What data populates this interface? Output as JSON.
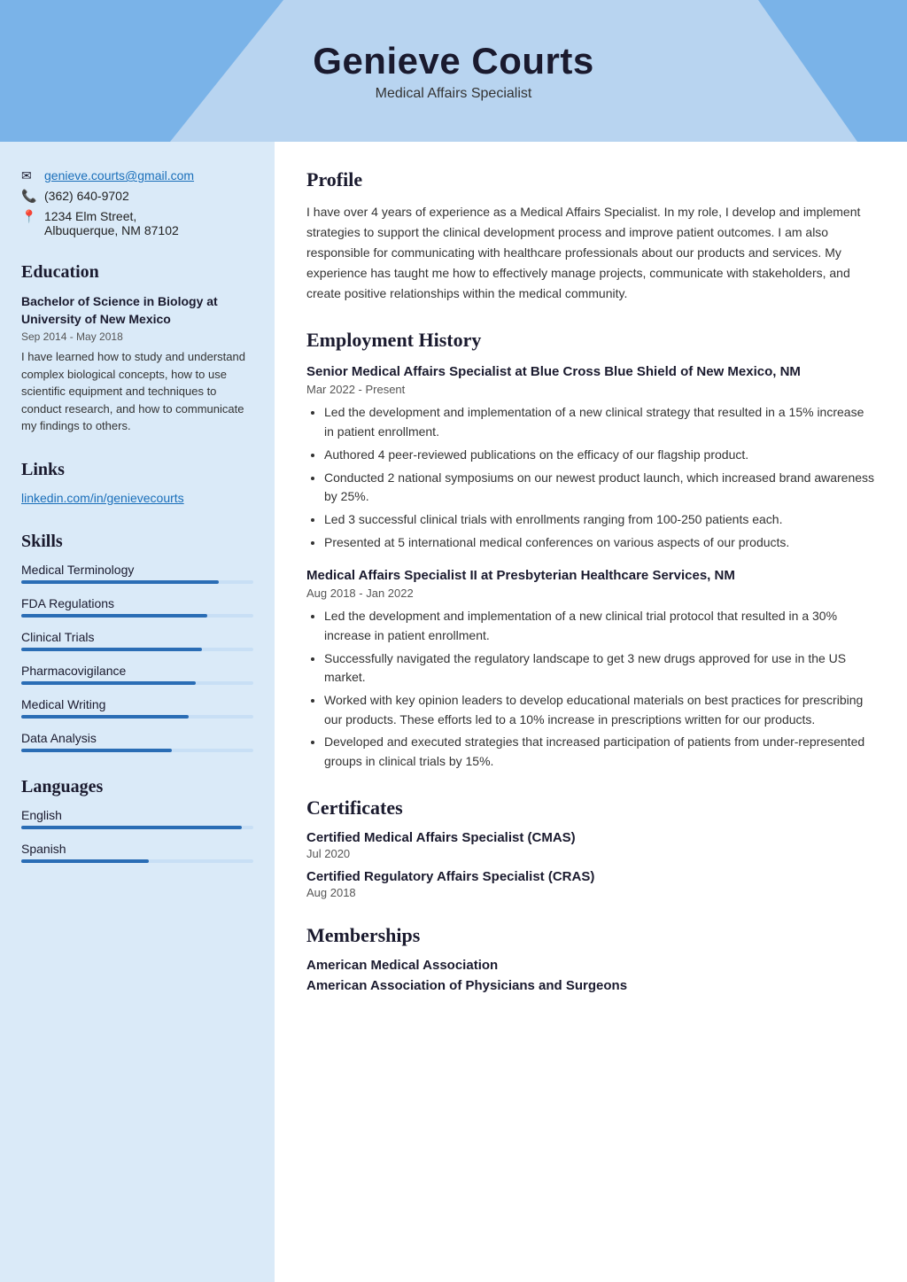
{
  "header": {
    "name": "Genieve Courts",
    "title": "Medical Affairs Specialist"
  },
  "sidebar": {
    "contact": {
      "email": "genieve.courts@gmail.com",
      "phone": "(362) 640-9702",
      "address_line1": "1234 Elm Street,",
      "address_line2": "Albuquerque, NM 87102"
    },
    "education_title": "Education",
    "education": {
      "degree": "Bachelor of Science in Biology at University of New Mexico",
      "date": "Sep 2014 - May 2018",
      "description": "I have learned how to study and understand complex biological concepts, how to use scientific equipment and techniques to conduct research, and how to communicate my findings to others."
    },
    "links_title": "Links",
    "links": [
      {
        "label": "linkedin.com/in/genievecourts",
        "url": "#"
      }
    ],
    "skills_title": "Skills",
    "skills": [
      {
        "name": "Medical Terminology",
        "percent": 85
      },
      {
        "name": "FDA Regulations",
        "percent": 80
      },
      {
        "name": "Clinical Trials",
        "percent": 78
      },
      {
        "name": "Pharmacovigilance",
        "percent": 75
      },
      {
        "name": "Medical Writing",
        "percent": 72
      },
      {
        "name": "Data Analysis",
        "percent": 65
      }
    ],
    "languages_title": "Languages",
    "languages": [
      {
        "name": "English",
        "percent": 95
      },
      {
        "name": "Spanish",
        "percent": 55
      }
    ]
  },
  "content": {
    "profile_title": "Profile",
    "profile_text": "I have over 4 years of experience as a Medical Affairs Specialist. In my role, I develop and implement strategies to support the clinical development process and improve patient outcomes. I am also responsible for communicating with healthcare professionals about our products and services. My experience has taught me how to effectively manage projects, communicate with stakeholders, and create positive relationships within the medical community.",
    "employment_title": "Employment History",
    "jobs": [
      {
        "title": "Senior Medical Affairs Specialist at Blue Cross Blue Shield of New Mexico, NM",
        "date": "Mar 2022 - Present",
        "bullets": [
          "Led the development and implementation of a new clinical strategy that resulted in a 15% increase in patient enrollment.",
          "Authored 4 peer-reviewed publications on the efficacy of our flagship product.",
          "Conducted 2 national symposiums on our newest product launch, which increased brand awareness by 25%.",
          "Led 3 successful clinical trials with enrollments ranging from 100-250 patients each.",
          "Presented at 5 international medical conferences on various aspects of our products."
        ]
      },
      {
        "title": "Medical Affairs Specialist II at Presbyterian Healthcare Services, NM",
        "date": "Aug 2018 - Jan 2022",
        "bullets": [
          "Led the development and implementation of a new clinical trial protocol that resulted in a 30% increase in patient enrollment.",
          "Successfully navigated the regulatory landscape to get 3 new drugs approved for use in the US market.",
          "Worked with key opinion leaders to develop educational materials on best practices for prescribing our products. These efforts led to a 10% increase in prescriptions written for our products.",
          "Developed and executed strategies that increased participation of patients from under-represented groups in clinical trials by 15%."
        ]
      }
    ],
    "certificates_title": "Certificates",
    "certificates": [
      {
        "name": "Certified Medical Affairs Specialist (CMAS)",
        "date": "Jul 2020"
      },
      {
        "name": "Certified Regulatory Affairs Specialist (CRAS)",
        "date": "Aug 2018"
      }
    ],
    "memberships_title": "Memberships",
    "memberships": [
      {
        "name": "American Medical Association"
      },
      {
        "name": "American Association of Physicians and Surgeons"
      }
    ]
  }
}
